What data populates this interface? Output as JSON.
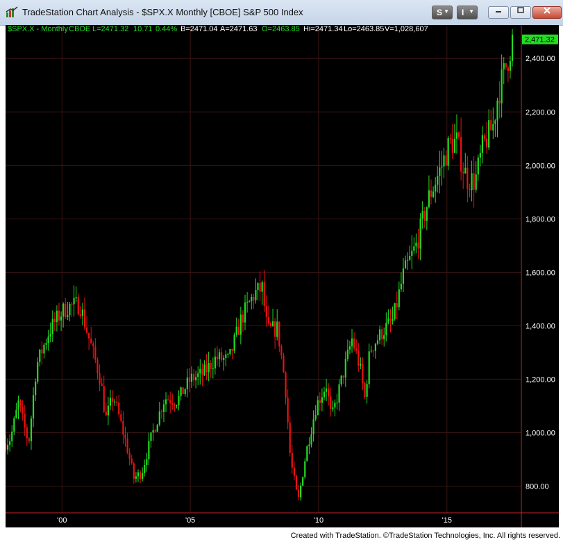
{
  "window": {
    "title": "TradeStation Chart Analysis - $SPX.X Monthly [CBOE] S&P 500 Index",
    "btn_s": "S",
    "btn_i": "I",
    "minimize_icon": "minimize-icon",
    "restore_icon": "restore-icon",
    "close_icon": "close-icon"
  },
  "status": {
    "symbol": "$SPX.X - Monthly",
    "exchange": "CBOE",
    "last": "L=2471.32",
    "change": "10.71",
    "pct": "0.44%",
    "bid": "B=2471.04",
    "ask": "A=2471.63",
    "open": "O=2463.85",
    "high": "Hi=2471.34",
    "low": "Lo=2463.85",
    "volume": "V=1,028,607"
  },
  "footer": "Created with TradeStation. ©TradeStation Technologies, Inc. All rights reserved.",
  "chart_data": {
    "type": "candlestick",
    "title": "$SPX.X Monthly [CBOE] S&P 500 Index",
    "last_price_label": "2,471.32",
    "ylim": [
      700,
      2520
    ],
    "yticks": [
      800,
      1000,
      1200,
      1400,
      1600,
      1800,
      2000,
      2200,
      2400
    ],
    "ytick_labels": [
      "800.00",
      "1,000.00",
      "1,200.00",
      "1,400.00",
      "1,600.00",
      "1,800.00",
      "2,000.00",
      "2,200.00",
      "2,400.00"
    ],
    "xlim": [
      1997.8,
      2017.9
    ],
    "xticks": [
      2000,
      2005,
      2010,
      2015
    ],
    "xtick_labels": [
      "'00",
      "'05",
      "'10",
      "'15"
    ],
    "grid": true,
    "colors": {
      "up": "#22dd22",
      "down": "#ee1111",
      "grid": "#3c1414",
      "axis": "#cc2222",
      "text": "#ffffff",
      "last_bg": "#22dd22"
    },
    "anchors": [
      [
        1997.8,
        960
      ],
      [
        1998.0,
        980
      ],
      [
        1998.3,
        1110
      ],
      [
        1998.7,
        960
      ],
      [
        1999.0,
        1250
      ],
      [
        1999.5,
        1380
      ],
      [
        1999.9,
        1440
      ],
      [
        2000.2,
        1470
      ],
      [
        2000.7,
        1480
      ],
      [
        2001.0,
        1370
      ],
      [
        2001.5,
        1200
      ],
      [
        2001.7,
        1050
      ],
      [
        2002.0,
        1140
      ],
      [
        2002.5,
        960
      ],
      [
        2002.8,
        830
      ],
      [
        2003.1,
        850
      ],
      [
        2003.5,
        990
      ],
      [
        2004.0,
        1130
      ],
      [
        2004.5,
        1120
      ],
      [
        2005.0,
        1200
      ],
      [
        2005.5,
        1220
      ],
      [
        2006.0,
        1280
      ],
      [
        2006.5,
        1270
      ],
      [
        2007.0,
        1430
      ],
      [
        2007.5,
        1520
      ],
      [
        2007.8,
        1540
      ],
      [
        2008.0,
        1380
      ],
      [
        2008.4,
        1390
      ],
      [
        2008.7,
        1180
      ],
      [
        2008.9,
        900
      ],
      [
        2009.2,
        740
      ],
      [
        2009.5,
        920
      ],
      [
        2009.9,
        1100
      ],
      [
        2010.3,
        1180
      ],
      [
        2010.5,
        1050
      ],
      [
        2010.9,
        1200
      ],
      [
        2011.3,
        1350
      ],
      [
        2011.6,
        1250
      ],
      [
        2011.8,
        1130
      ],
      [
        2012.0,
        1310
      ],
      [
        2012.5,
        1380
      ],
      [
        2012.9,
        1420
      ],
      [
        2013.3,
        1590
      ],
      [
        2013.8,
        1700
      ],
      [
        2014.3,
        1880
      ],
      [
        2014.8,
        2000
      ],
      [
        2015.1,
        2080
      ],
      [
        2015.4,
        2090
      ],
      [
        2015.6,
        2000
      ],
      [
        2015.8,
        1950
      ],
      [
        2016.1,
        1940
      ],
      [
        2016.4,
        2070
      ],
      [
        2016.8,
        2150
      ],
      [
        2017.0,
        2270
      ],
      [
        2017.3,
        2370
      ],
      [
        2017.55,
        2470
      ]
    ]
  }
}
